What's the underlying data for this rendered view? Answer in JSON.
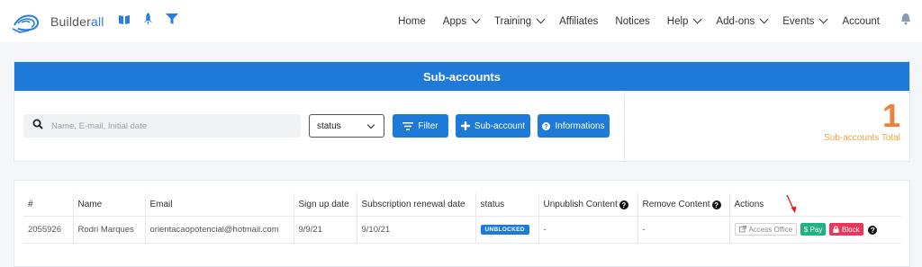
{
  "brand": {
    "name_prefix": "Builder",
    "name_suffix": "all",
    "accent_color": "#1d7ad8"
  },
  "quick_icons": [
    "book-icon",
    "rocket-icon",
    "filter-icon"
  ],
  "nav": {
    "items": [
      {
        "label": "Home",
        "dropdown": false
      },
      {
        "label": "Apps",
        "dropdown": true
      },
      {
        "label": "Training",
        "dropdown": true
      },
      {
        "label": "Affiliates",
        "dropdown": false
      },
      {
        "label": "Notices",
        "dropdown": false
      },
      {
        "label": "Help",
        "dropdown": true
      },
      {
        "label": "Add-ons",
        "dropdown": true
      },
      {
        "label": "Events",
        "dropdown": true
      },
      {
        "label": "Account",
        "dropdown": false
      }
    ]
  },
  "panel": {
    "title": "Sub-accounts",
    "search_placeholder": "Name, E-mail, Initial date",
    "status_value": "status",
    "filter_label": "Filter",
    "add_label": "Sub-account",
    "info_label": "Informations",
    "total_count": "1",
    "total_label": "Sub-accounts Total",
    "total_color": "#ef7f3b"
  },
  "table": {
    "headers": {
      "id": "#",
      "name": "Name",
      "email": "Email",
      "signup": "Sign up date",
      "renewal": "Subscription renewal date",
      "status": "status",
      "unpublish": "Unpublish Content",
      "remove": "Remove Content",
      "actions": "Actions"
    },
    "rows": [
      {
        "id": "2055926",
        "name": "Rodri Marques",
        "email": "orientacaopotencial@hotmail.com",
        "signup": "9/9/21",
        "renewal": "9/10/21",
        "status": "UNBLOCKED",
        "unpublish": "-",
        "remove": "-",
        "actions": {
          "office": "Access Office",
          "pay": "$ Pay",
          "block": "Block"
        }
      }
    ]
  }
}
